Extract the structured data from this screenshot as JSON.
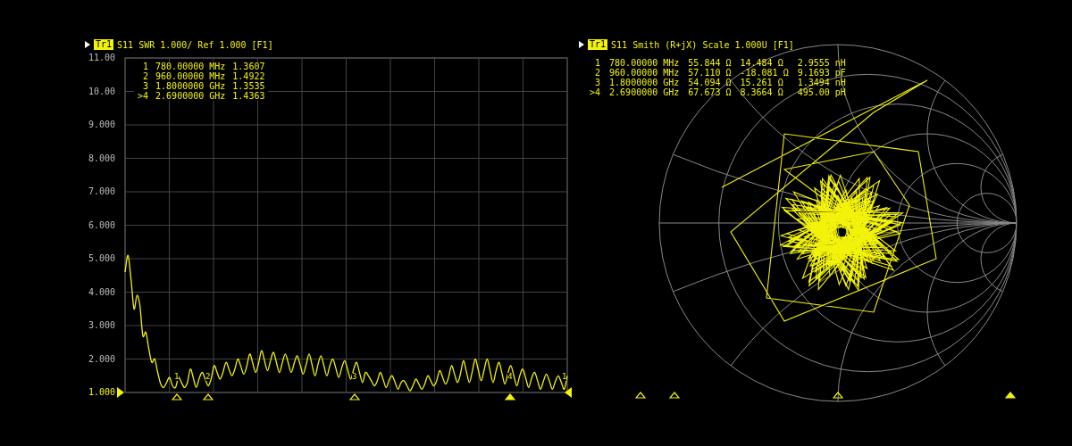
{
  "swr_panel": {
    "trace_label": "Tr1",
    "header": "S11 SWR 1.000/ Ref 1.000 [F1]",
    "chart_data": {
      "type": "line",
      "grid": true,
      "ylim": [
        1,
        11
      ],
      "yticks": [
        {
          "value": 11,
          "label": "11.00"
        },
        {
          "value": 10,
          "label": "10.00"
        },
        {
          "value": 9,
          "label": "9.000"
        },
        {
          "value": 8,
          "label": "8.000"
        },
        {
          "value": 7,
          "label": "7.000"
        },
        {
          "value": 6,
          "label": "6.000"
        },
        {
          "value": 5,
          "label": "5.000"
        },
        {
          "value": 4,
          "label": "4.000"
        },
        {
          "value": 3,
          "label": "3.000"
        },
        {
          "value": 2,
          "label": "2.000"
        }
      ],
      "series": [
        {
          "color": "#f2f20a",
          "values": [
            4.6,
            5.1,
            4.4,
            3.5,
            3.9,
            3.6,
            2.7,
            2.8,
            2.3,
            1.9,
            2.0,
            1.6,
            1.25,
            1.15,
            1.3,
            1.45,
            1.2,
            1.15,
            1.45,
            1.3,
            1.15,
            1.3,
            1.7,
            1.43,
            1.15,
            1.43,
            1.6,
            1.4,
            1.2,
            1.4,
            1.8,
            1.6,
            1.4,
            1.6,
            1.9,
            1.7,
            1.5,
            1.7,
            2.0,
            1.78,
            1.55,
            1.78,
            2.15,
            1.88,
            1.6,
            1.88,
            2.25,
            1.95,
            1.65,
            1.95,
            2.2,
            1.9,
            1.6,
            1.9,
            2.15,
            1.88,
            1.6,
            1.88,
            2.1,
            1.83,
            1.55,
            1.83,
            2.15,
            1.83,
            1.5,
            1.83,
            2.1,
            1.8,
            1.5,
            1.8,
            2.0,
            1.73,
            1.45,
            1.73,
            1.95,
            1.68,
            1.4,
            1.68,
            1.9,
            1.6,
            1.3,
            1.6,
            1.5,
            1.35,
            1.2,
            1.35,
            1.6,
            1.38,
            1.15,
            1.38,
            1.5,
            1.3,
            1.1,
            1.3,
            1.35,
            1.2,
            1.05,
            1.2,
            1.4,
            1.25,
            1.1,
            1.25,
            1.5,
            1.35,
            1.2,
            1.35,
            1.65,
            1.45,
            1.25,
            1.45,
            1.8,
            1.55,
            1.3,
            1.55,
            1.95,
            1.63,
            1.3,
            1.63,
            2.0,
            1.68,
            1.35,
            1.68,
            2.0,
            1.65,
            1.3,
            1.65,
            1.9,
            1.58,
            1.25,
            1.58,
            1.8,
            1.5,
            1.2,
            1.5,
            1.7,
            1.43,
            1.15,
            1.43,
            1.6,
            1.35,
            1.1,
            1.35,
            1.55,
            1.33,
            1.1,
            1.33,
            1.5,
            1.3,
            1.1,
            1.5
          ]
        }
      ]
    },
    "ref_level": "1.000",
    "readouts": [
      {
        "marker": "1",
        "frequency": "780.00000 MHz",
        "value": "1.3607"
      },
      {
        "marker": "2",
        "frequency": "960.00000 MHz",
        "value": "1.4922"
      },
      {
        "marker": "3",
        "frequency": "1.8000000 GHz",
        "value": "1.3535"
      },
      {
        "marker": ">4",
        "frequency": "2.6900000 GHz",
        "value": "1.4363"
      }
    ],
    "trace_markers": [
      {
        "label": "1",
        "selected": false
      },
      {
        "label": "2",
        "selected": false
      },
      {
        "label": "3",
        "selected": false
      },
      {
        "label": "4",
        "selected": true
      }
    ],
    "end_label": "1"
  },
  "smith_panel": {
    "trace_label": "Tr1",
    "header": "S11 Smith (R+jX) Scale 1.000U [F1]",
    "readouts": [
      {
        "marker": "1",
        "frequency": "780.00000 MHz",
        "resistance": "55.844 Ω",
        "reactance": "14.484 Ω",
        "component": "2.9555 nH"
      },
      {
        "marker": "2",
        "frequency": "960.00000 MHz",
        "resistance": "57.110 Ω",
        "reactance": "-18.081 Ω",
        "component": "9.1693 pF"
      },
      {
        "marker": "3",
        "frequency": "1.8000000 GHz",
        "resistance": "54.094 Ω",
        "reactance": "15.261 Ω",
        "component": "1.3494 nH"
      },
      {
        "marker": ">4",
        "frequency": "2.6900000 GHz",
        "resistance": "67.673 Ω",
        "reactance": "8.3664 Ω",
        "component": "495.00 pH"
      }
    ],
    "markers": [
      {
        "selected": false
      },
      {
        "selected": false
      },
      {
        "selected": false
      },
      {
        "selected": true
      }
    ]
  }
}
